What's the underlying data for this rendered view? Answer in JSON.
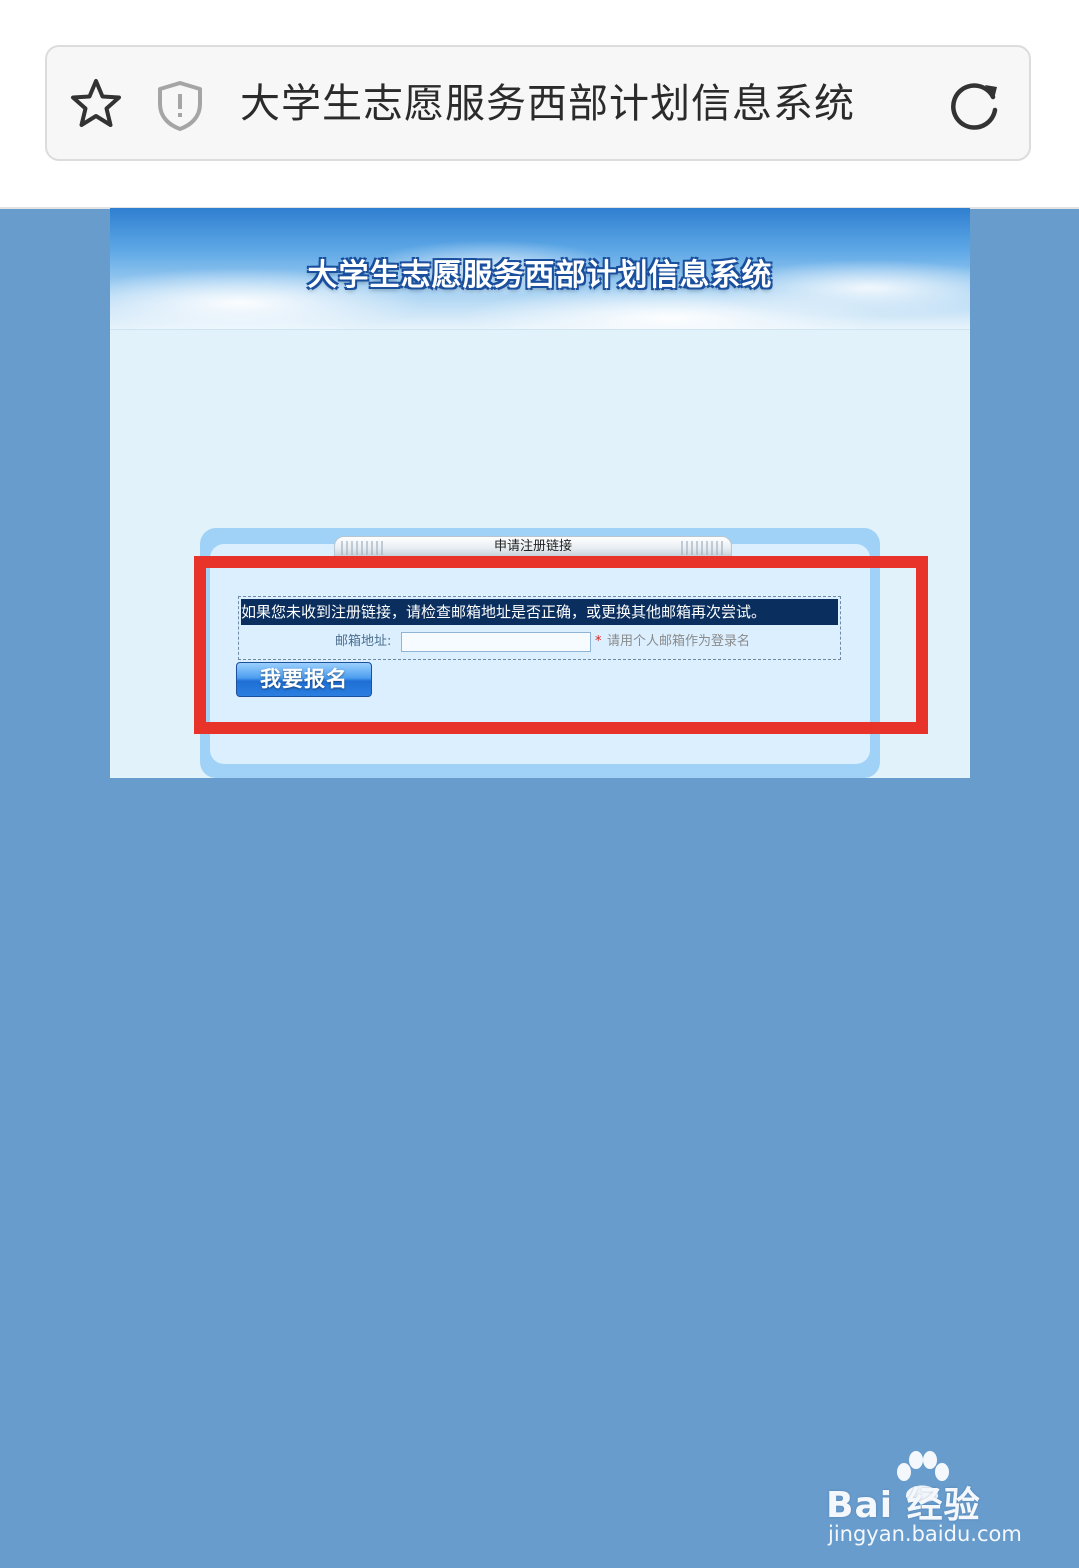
{
  "browser": {
    "address_title": "大学生志愿服务西部计划信息系统",
    "icons": [
      "star-icon",
      "shield-icon",
      "reload-icon"
    ]
  },
  "page": {
    "banner_title": "大学生志愿服务西部计划信息系统",
    "panel_title": "申请注册链接",
    "notice": "如果您未收到注册链接，请检查邮箱地址是否正确，或更换其他邮箱再次尝试。",
    "email_label": "邮箱地址:",
    "email_value": "",
    "required_mark": "*",
    "email_hint": "请用个人邮箱作为登录名",
    "register_button": "我要报名"
  },
  "watermark": {
    "brand": "Bai  经验",
    "url": "jingyan.baidu.com"
  },
  "colors": {
    "page_background": "#679ccd",
    "notice_background": "#0a2f5e",
    "highlight": "#e8332b",
    "button": "#2b7fe0"
  }
}
